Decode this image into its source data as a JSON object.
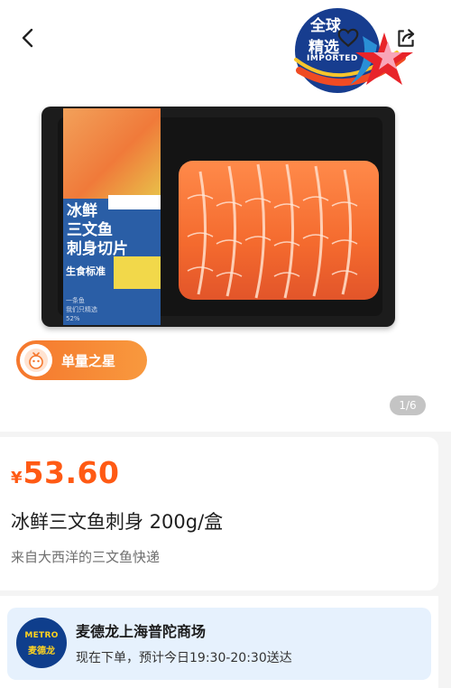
{
  "nav": {
    "back_icon": "chevron-left-icon",
    "favorite_icon": "heart-icon",
    "share_icon": "share-icon"
  },
  "badge": {
    "line1": "全球",
    "line2": "精选",
    "line3": "IMPORTED"
  },
  "product_image": {
    "label_title": "冰鲜\n三文鱼\n刺身切片",
    "label_standard": "生食标准",
    "label_small": "一条鱼\n我们只精选\n52%",
    "star_tag": "单量之星",
    "pager": "1/6"
  },
  "product": {
    "currency": "¥",
    "price": "53.60",
    "title": "冰鲜三文鱼刺身 200g/盒",
    "subtitle": "来自大西洋的三文鱼快递"
  },
  "store": {
    "logo_text": "METRO",
    "logo_cn": "麦德龙",
    "name": "麦德龙上海普陀商场",
    "delivery": "现在下单，预计今日19:30-20:30送达"
  },
  "colors": {
    "price": "#ff5a14",
    "star_tag": "#f5772d",
    "store_card": "#e6f1fd",
    "metro_blue": "#0f3e8c",
    "metro_yellow": "#ffd31f"
  }
}
